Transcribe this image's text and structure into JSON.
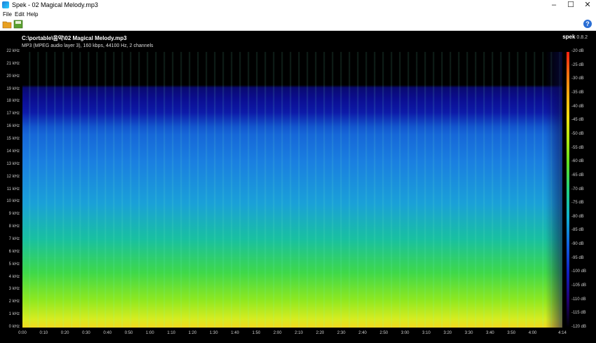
{
  "window": {
    "title": "Spek - 02 Magical Melody.mp3",
    "minimize": "–",
    "maximize": "☐",
    "close": "✕"
  },
  "menu": {
    "items": [
      "File",
      "Edit",
      "Help"
    ]
  },
  "toolbar": {
    "open_icon": "folder-icon",
    "save_icon": "save-icon",
    "help_label": "?"
  },
  "header": {
    "file_path": "C:\\portable\\음악\\02 Magical Melody.mp3",
    "info": "MP3 (MPEG audio layer 3), 160 kbps, 44100 Hz, 2 channels",
    "brand": "spek",
    "version": "0.8.2"
  },
  "freq_axis": [
    "22 kHz",
    "21 kHz",
    "20 kHz",
    "19 kHz",
    "18 kHz",
    "17 kHz",
    "16 kHz",
    "15 kHz",
    "14 kHz",
    "13 kHz",
    "12 kHz",
    "11 kHz",
    "10 kHz",
    "9 kHz",
    "8 kHz",
    "7 kHz",
    "6 kHz",
    "5 kHz",
    "4 kHz",
    "3 kHz",
    "2 kHz",
    "1 kHz",
    "0 kHz"
  ],
  "db_axis": [
    "-20 dB",
    "-25 dB",
    "-30 dB",
    "-35 dB",
    "-40 dB",
    "-45 dB",
    "-50 dB",
    "-55 dB",
    "-60 dB",
    "-65 dB",
    "-70 dB",
    "-75 dB",
    "-80 dB",
    "-85 dB",
    "-90 dB",
    "-95 dB",
    "-100 dB",
    "-105 dB",
    "-110 dB",
    "-115 dB",
    "-120 dB"
  ],
  "time_axis": [
    "0:00",
    "0:10",
    "0:20",
    "0:30",
    "0:40",
    "0:50",
    "1:00",
    "1:10",
    "1:20",
    "1:30",
    "1:40",
    "1:50",
    "2:00",
    "2:10",
    "2:20",
    "2:30",
    "2:40",
    "2:50",
    "3:00",
    "3:10",
    "3:20",
    "3:30",
    "3:40",
    "3:50",
    "4:00",
    "4:14"
  ],
  "colors": {
    "background": "#000000",
    "hot": "#ff2010",
    "cold": "#000000"
  }
}
